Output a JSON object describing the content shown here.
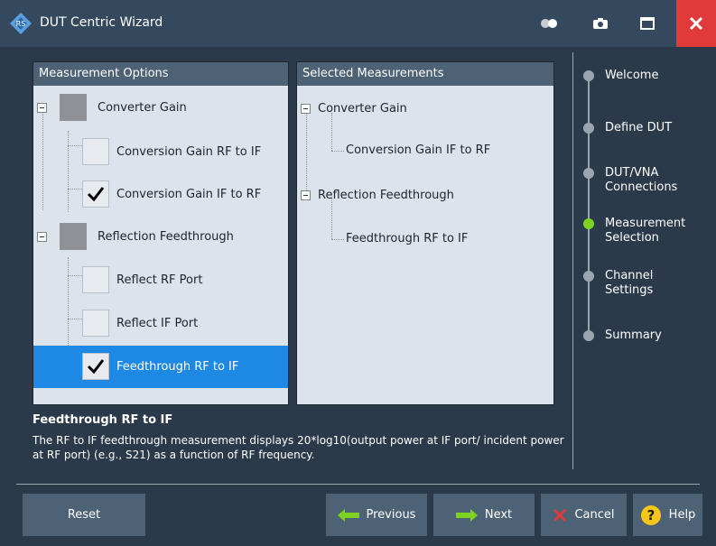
{
  "window": {
    "title": "DUT Centric Wizard"
  },
  "left_panel": {
    "header": "Measurement Options",
    "items": [
      {
        "label": "Converter Gain",
        "checked": null
      },
      {
        "label": "Conversion Gain RF to IF",
        "checked": false
      },
      {
        "label": "Conversion Gain IF to RF",
        "checked": true
      },
      {
        "label": "Reflection Feedthrough",
        "checked": null
      },
      {
        "label": "Reflect RF Port",
        "checked": false
      },
      {
        "label": "Reflect IF Port",
        "checked": false
      },
      {
        "label": "Feedthrough RF to IF",
        "checked": true,
        "selected": true
      }
    ]
  },
  "right_panel": {
    "header": "Selected Measurements",
    "items": [
      {
        "label": "Converter Gain"
      },
      {
        "label": "Conversion Gain IF to RF"
      },
      {
        "label": "Reflection Feedthrough"
      },
      {
        "label": "Feedthrough RF to IF"
      }
    ]
  },
  "description": {
    "title": "Feedthrough RF to IF",
    "text": "The RF to IF feedthrough measurement displays 20*log10(output power at IF port/ incident power at RF port) (e.g., S21) as a function of RF frequency."
  },
  "steps": [
    {
      "label": "Welcome",
      "active": false
    },
    {
      "label": "Define DUT",
      "active": false
    },
    {
      "label": "DUT/VNA Connections",
      "active": false
    },
    {
      "label": "Measurement Selection",
      "active": true
    },
    {
      "label": "Channel Settings",
      "active": false
    },
    {
      "label": "Summary",
      "active": false
    }
  ],
  "buttons": {
    "reset": "Reset",
    "previous": "Previous",
    "next": "Next",
    "cancel": "Cancel",
    "help": "Help"
  },
  "colors": {
    "accent": "#1e88e5",
    "active_step": "#7ed321",
    "arrow": "#7ed321",
    "cancel_x": "#e03a3a",
    "help": "#f5c518",
    "close": "#e03a3a"
  }
}
